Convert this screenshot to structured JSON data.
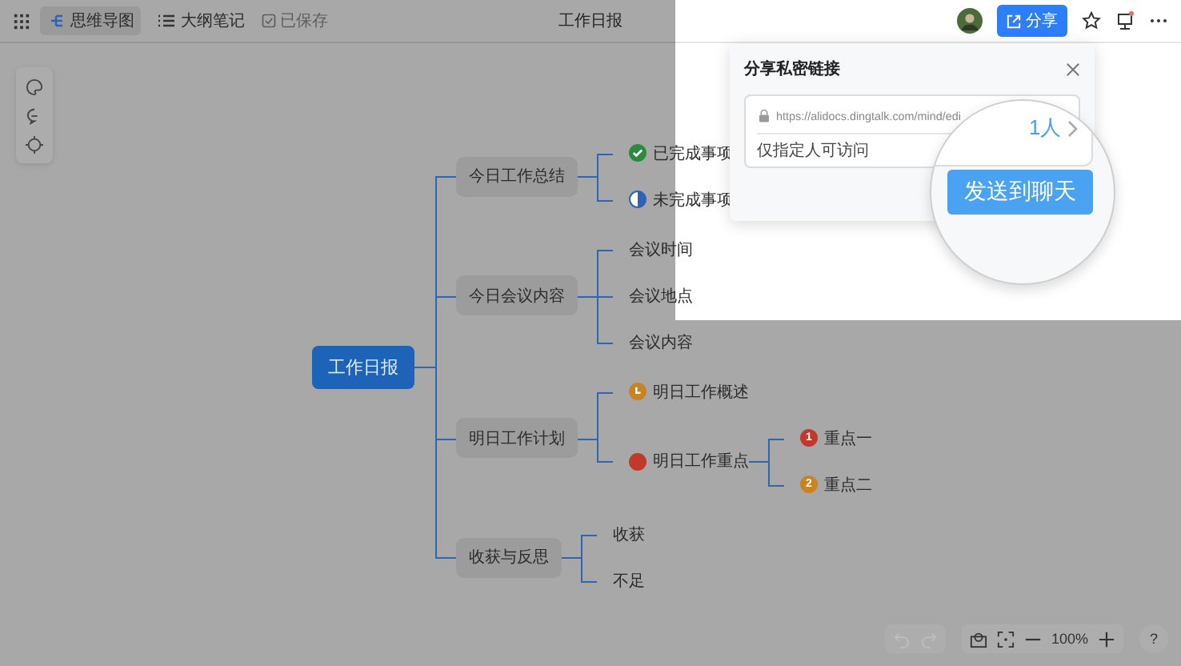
{
  "toolbar": {
    "tabs": [
      {
        "label": "思维导图",
        "selected": true
      },
      {
        "label": "大纲笔记",
        "selected": false
      }
    ],
    "save_status": "已保存",
    "title": "工作日报",
    "share_button": "分享"
  },
  "mind_map": {
    "root": "工作日报",
    "children": [
      {
        "label": "今日工作总结",
        "children": [
          {
            "label": "已完成事项",
            "marker": {
              "kind": "check",
              "color": "#2a8a3e"
            }
          },
          {
            "label": "未完成事项",
            "marker": {
              "kind": "half",
              "color": "#2b63b5"
            }
          }
        ]
      },
      {
        "label": "今日会议内容",
        "children": [
          {
            "label": "会议时间"
          },
          {
            "label": "会议地点"
          },
          {
            "label": "会议内容"
          }
        ]
      },
      {
        "label": "明日工作计划",
        "children": [
          {
            "label": "明日工作概述",
            "marker": {
              "kind": "clock",
              "color": "#c98322"
            }
          },
          {
            "label": "明日工作重点",
            "marker": {
              "kind": "dot",
              "color": "#c0392b"
            },
            "children": [
              {
                "label": "重点一",
                "marker": {
                  "kind": "number",
                  "text": "1",
                  "color": "#c0392b"
                }
              },
              {
                "label": "重点二",
                "marker": {
                  "kind": "number",
                  "text": "2",
                  "color": "#c98322"
                }
              }
            ]
          }
        ]
      },
      {
        "label": "收获与反思",
        "children": [
          {
            "label": "收获"
          },
          {
            "label": "不足"
          }
        ]
      }
    ]
  },
  "share_dialog": {
    "title": "分享私密链接",
    "link": "https://alidocs.dingtalk.com/mind/edi",
    "access": "仅指定人可访问",
    "members": "1人",
    "send_button": "发送到聊天"
  },
  "history": {
    "undo_disabled": true,
    "redo_disabled": true
  },
  "zoom": {
    "level_text": "100%"
  },
  "help": "?"
}
